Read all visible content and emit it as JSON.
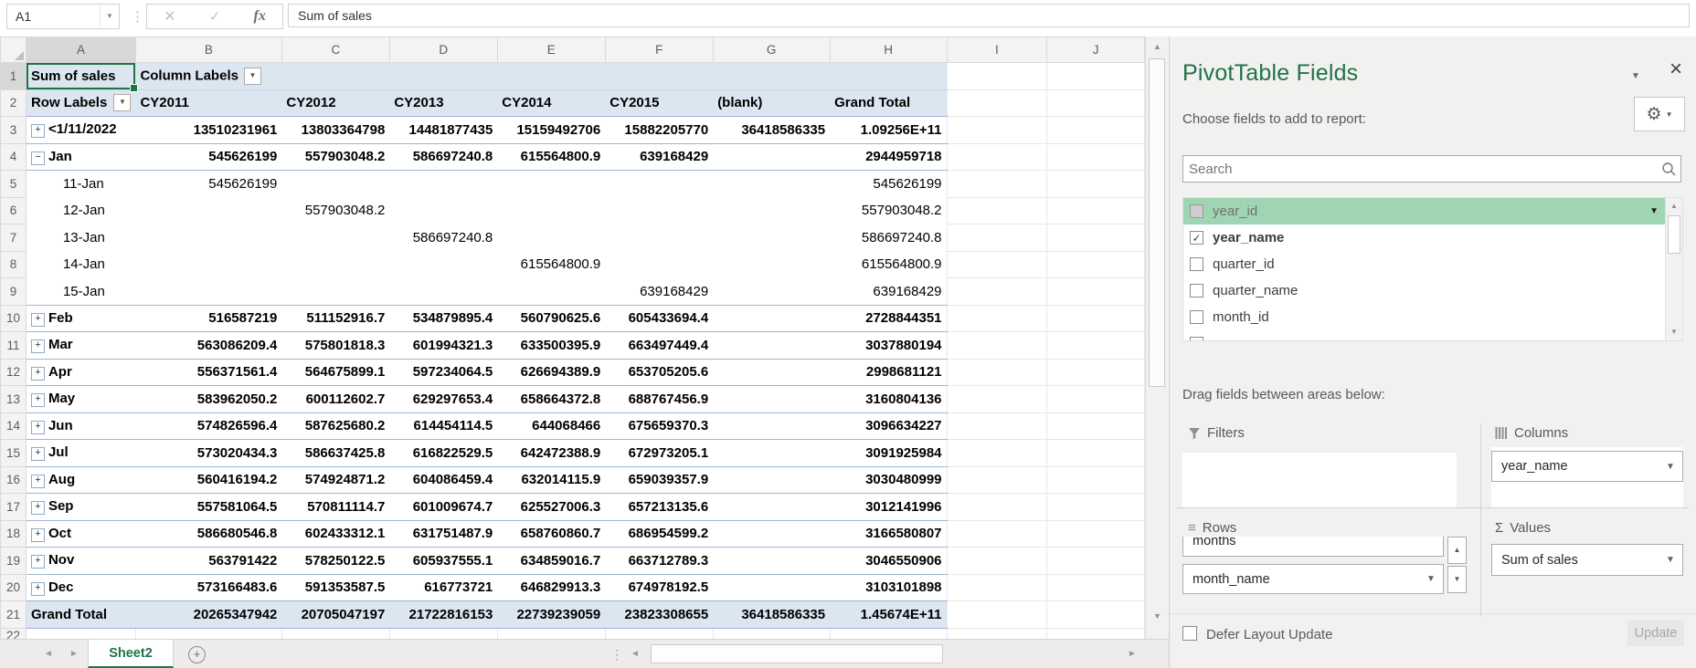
{
  "formula_bar": {
    "name_box": "A1",
    "formula": "Sum of sales",
    "fx": "fx"
  },
  "grid": {
    "column_letters": [
      "A",
      "B",
      "C",
      "D",
      "E",
      "F",
      "G",
      "H",
      "I",
      "J"
    ],
    "selected_cell": "A1",
    "partial_bottom_row": "22",
    "pivot": {
      "a1": "Sum of sales",
      "column_labels": "Column Labels",
      "row_labels": "Row Labels",
      "col_headers": [
        "CY2011",
        "CY2012",
        "CY2013",
        "CY2014",
        "CY2015",
        "(blank)",
        "Grand Total"
      ],
      "rows": [
        {
          "n": 3,
          "label": "<1/11/2022",
          "toggle": "+",
          "bold": true,
          "values": [
            "13510231961",
            "13803364798",
            "14481877435",
            "15159492706",
            "15882205770",
            "36418586335",
            "1.09256E+11"
          ]
        },
        {
          "n": 4,
          "label": "Jan",
          "toggle": "-",
          "bold": true,
          "values": [
            "545626199",
            "557903048.2",
            "586697240.8",
            "615564800.9",
            "639168429",
            "",
            "2944959718"
          ]
        },
        {
          "n": 5,
          "label": "11-Jan",
          "toggle": null,
          "bold": false,
          "values": [
            "545626199",
            "",
            "",
            "",
            "",
            "",
            "545626199"
          ]
        },
        {
          "n": 6,
          "label": "12-Jan",
          "toggle": null,
          "bold": false,
          "values": [
            "",
            "557903048.2",
            "",
            "",
            "",
            "",
            "557903048.2"
          ]
        },
        {
          "n": 7,
          "label": "13-Jan",
          "toggle": null,
          "bold": false,
          "values": [
            "",
            "",
            "586697240.8",
            "",
            "",
            "",
            "586697240.8"
          ]
        },
        {
          "n": 8,
          "label": "14-Jan",
          "toggle": null,
          "bold": false,
          "values": [
            "",
            "",
            "",
            "615564800.9",
            "",
            "",
            "615564800.9"
          ]
        },
        {
          "n": 9,
          "label": "15-Jan",
          "toggle": null,
          "bold": false,
          "values": [
            "",
            "",
            "",
            "",
            "639168429",
            "",
            "639168429"
          ]
        },
        {
          "n": 10,
          "label": "Feb",
          "toggle": "+",
          "bold": true,
          "values": [
            "516587219",
            "511152916.7",
            "534879895.4",
            "560790625.6",
            "605433694.4",
            "",
            "2728844351"
          ]
        },
        {
          "n": 11,
          "label": "Mar",
          "toggle": "+",
          "bold": true,
          "values": [
            "563086209.4",
            "575801818.3",
            "601994321.3",
            "633500395.9",
            "663497449.4",
            "",
            "3037880194"
          ]
        },
        {
          "n": 12,
          "label": "Apr",
          "toggle": "+",
          "bold": true,
          "values": [
            "556371561.4",
            "564675899.1",
            "597234064.5",
            "626694389.9",
            "653705205.6",
            "",
            "2998681121"
          ]
        },
        {
          "n": 13,
          "label": "May",
          "toggle": "+",
          "bold": true,
          "values": [
            "583962050.2",
            "600112602.7",
            "629297653.4",
            "658664372.8",
            "688767456.9",
            "",
            "3160804136"
          ]
        },
        {
          "n": 14,
          "label": "Jun",
          "toggle": "+",
          "bold": true,
          "values": [
            "574826596.4",
            "587625680.2",
            "614454114.5",
            "644068466",
            "675659370.3",
            "",
            "3096634227"
          ]
        },
        {
          "n": 15,
          "label": "Jul",
          "toggle": "+",
          "bold": true,
          "values": [
            "573020434.3",
            "586637425.8",
            "616822529.5",
            "642472388.9",
            "672973205.1",
            "",
            "3091925984"
          ]
        },
        {
          "n": 16,
          "label": "Aug",
          "toggle": "+",
          "bold": true,
          "values": [
            "560416194.2",
            "574924871.2",
            "604086459.4",
            "632014115.9",
            "659039357.9",
            "",
            "3030480999"
          ]
        },
        {
          "n": 17,
          "label": "Sep",
          "toggle": "+",
          "bold": true,
          "values": [
            "557581064.5",
            "570811114.7",
            "601009674.7",
            "625527006.3",
            "657213135.6",
            "",
            "3012141996"
          ]
        },
        {
          "n": 18,
          "label": "Oct",
          "toggle": "+",
          "bold": true,
          "values": [
            "586680546.8",
            "602433312.1",
            "631751487.9",
            "658760860.7",
            "686954599.2",
            "",
            "3166580807"
          ]
        },
        {
          "n": 19,
          "label": "Nov",
          "toggle": "+",
          "bold": true,
          "values": [
            "563791422",
            "578250122.5",
            "605937555.1",
            "634859016.7",
            "663712789.3",
            "",
            "3046550906"
          ]
        },
        {
          "n": 20,
          "label": "Dec",
          "toggle": "+",
          "bold": true,
          "values": [
            "573166483.6",
            "591353587.5",
            "616773721",
            "646829913.3",
            "674978192.5",
            "",
            "3103101898"
          ]
        },
        {
          "n": 21,
          "label": "Grand Total",
          "toggle": null,
          "bold": true,
          "total": true,
          "values": [
            "20265347942",
            "20705047197",
            "21722816153",
            "22739239059",
            "23823308655",
            "36418586335",
            "1.45674E+11"
          ]
        }
      ]
    }
  },
  "tab_bar": {
    "active_sheet": "Sheet2"
  },
  "panel": {
    "title": "PivotTable Fields",
    "choose_label": "Choose fields to add to report:",
    "search_placeholder": "Search",
    "fields": [
      {
        "label": "year_id",
        "state": "highlighted",
        "checkbox": "disabled",
        "has_dropdown": true
      },
      {
        "label": "year_name",
        "checked": true,
        "bold": true
      },
      {
        "label": "quarter_id"
      },
      {
        "label": "quarter_name"
      },
      {
        "label": "month_id"
      },
      {
        "label": "",
        "partial": true
      }
    ],
    "drag_label": "Drag fields between areas below:",
    "areas": {
      "filters": {
        "label": "Filters",
        "items": []
      },
      "columns": {
        "label": "Columns",
        "items": [
          "year_name"
        ]
      },
      "rows": {
        "label": "Rows",
        "items": [
          "months",
          "month_name"
        ],
        "first_item_clipped": true
      },
      "values": {
        "label": "Values",
        "items": [
          "Sum of sales"
        ]
      }
    },
    "defer_label": "Defer Layout Update",
    "update_label": "Update"
  },
  "colors": {
    "excel_green": "#217346",
    "pivot_header_blue": "#DCE6F1",
    "pivot_border_blue": "#9DB6D8",
    "field_highlight_green": "#9FD5B2"
  }
}
